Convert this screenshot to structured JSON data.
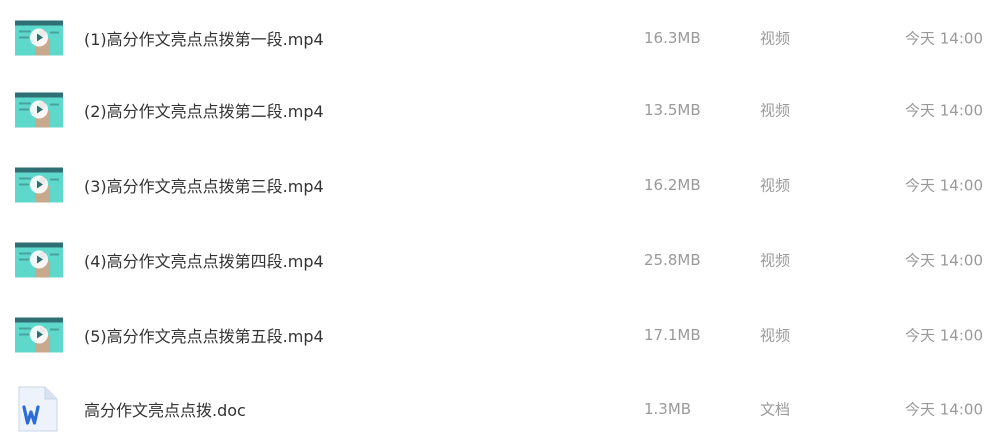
{
  "files": [
    {
      "name": "(1)高分作文亮点点拨第一段.mp4",
      "size": "16.3MB",
      "type": "视频",
      "time": "今天 14:00",
      "icon": "video-thumbnail"
    },
    {
      "name": "(2)高分作文亮点点拨第二段.mp4",
      "size": "13.5MB",
      "type": "视频",
      "time": "今天 14:00",
      "icon": "video-thumbnail"
    },
    {
      "name": "(3)高分作文亮点点拨第三段.mp4",
      "size": "16.2MB",
      "type": "视频",
      "time": "今天 14:00",
      "icon": "video-thumbnail"
    },
    {
      "name": "(4)高分作文亮点点拨第四段.mp4",
      "size": "25.8MB",
      "type": "视频",
      "time": "今天 14:00",
      "icon": "video-thumbnail"
    },
    {
      "name": "(5)高分作文亮点点拨第五段.mp4",
      "size": "17.1MB",
      "type": "视频",
      "time": "今天 14:00",
      "icon": "video-thumbnail"
    },
    {
      "name": "高分作文亮点点拨.doc",
      "size": "1.3MB",
      "type": "文档",
      "time": "今天 14:00",
      "icon": "word-document-icon"
    }
  ],
  "colors": {
    "thumbnail_bg": "#5fd8cc",
    "word_blue": "#2b6cd6",
    "meta_text": "#9a9a9a",
    "name_text": "#333333"
  }
}
